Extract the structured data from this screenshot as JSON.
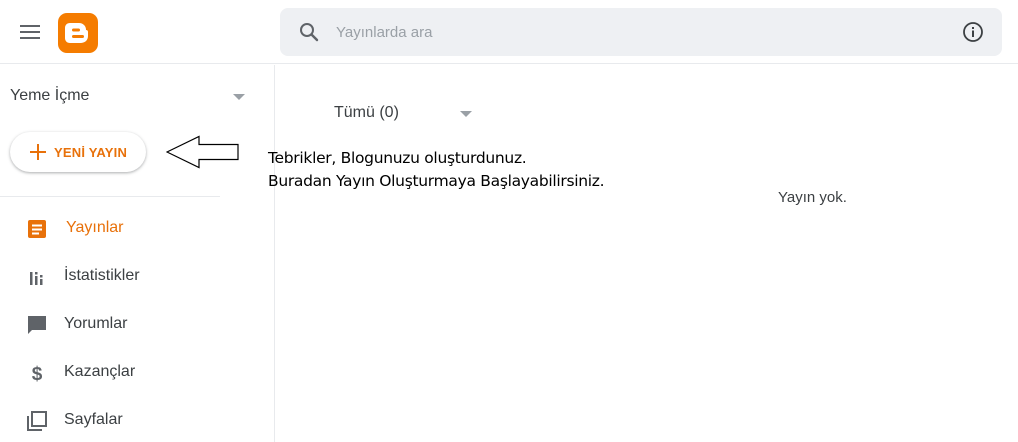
{
  "header": {
    "search_placeholder": "Yayınlarda ara"
  },
  "sidebar": {
    "blog_name": "Yeme İçme",
    "new_post_label": "YENİ YAYIN",
    "items": [
      {
        "label": "Yayınlar",
        "icon": "posts-icon",
        "active": true
      },
      {
        "label": "İstatistikler",
        "icon": "stats-icon",
        "active": false
      },
      {
        "label": "Yorumlar",
        "icon": "comments-icon",
        "active": false
      },
      {
        "label": "Kazançlar",
        "icon": "dollar-icon",
        "active": false
      },
      {
        "label": "Sayfalar",
        "icon": "pages-icon",
        "active": false
      }
    ]
  },
  "main": {
    "filter_label": "Tümü (0)",
    "empty_message": "Yayın yok."
  },
  "annotation": {
    "line1": "Tebrikler, Blogunuzu oluşturdunuz.",
    "line2": "Buradan Yayın Oluşturmaya Başlayabilirsiniz."
  },
  "colors": {
    "accent": "#e8710a",
    "icon_gray": "#5f6368",
    "search_bg": "#eef0f3"
  }
}
